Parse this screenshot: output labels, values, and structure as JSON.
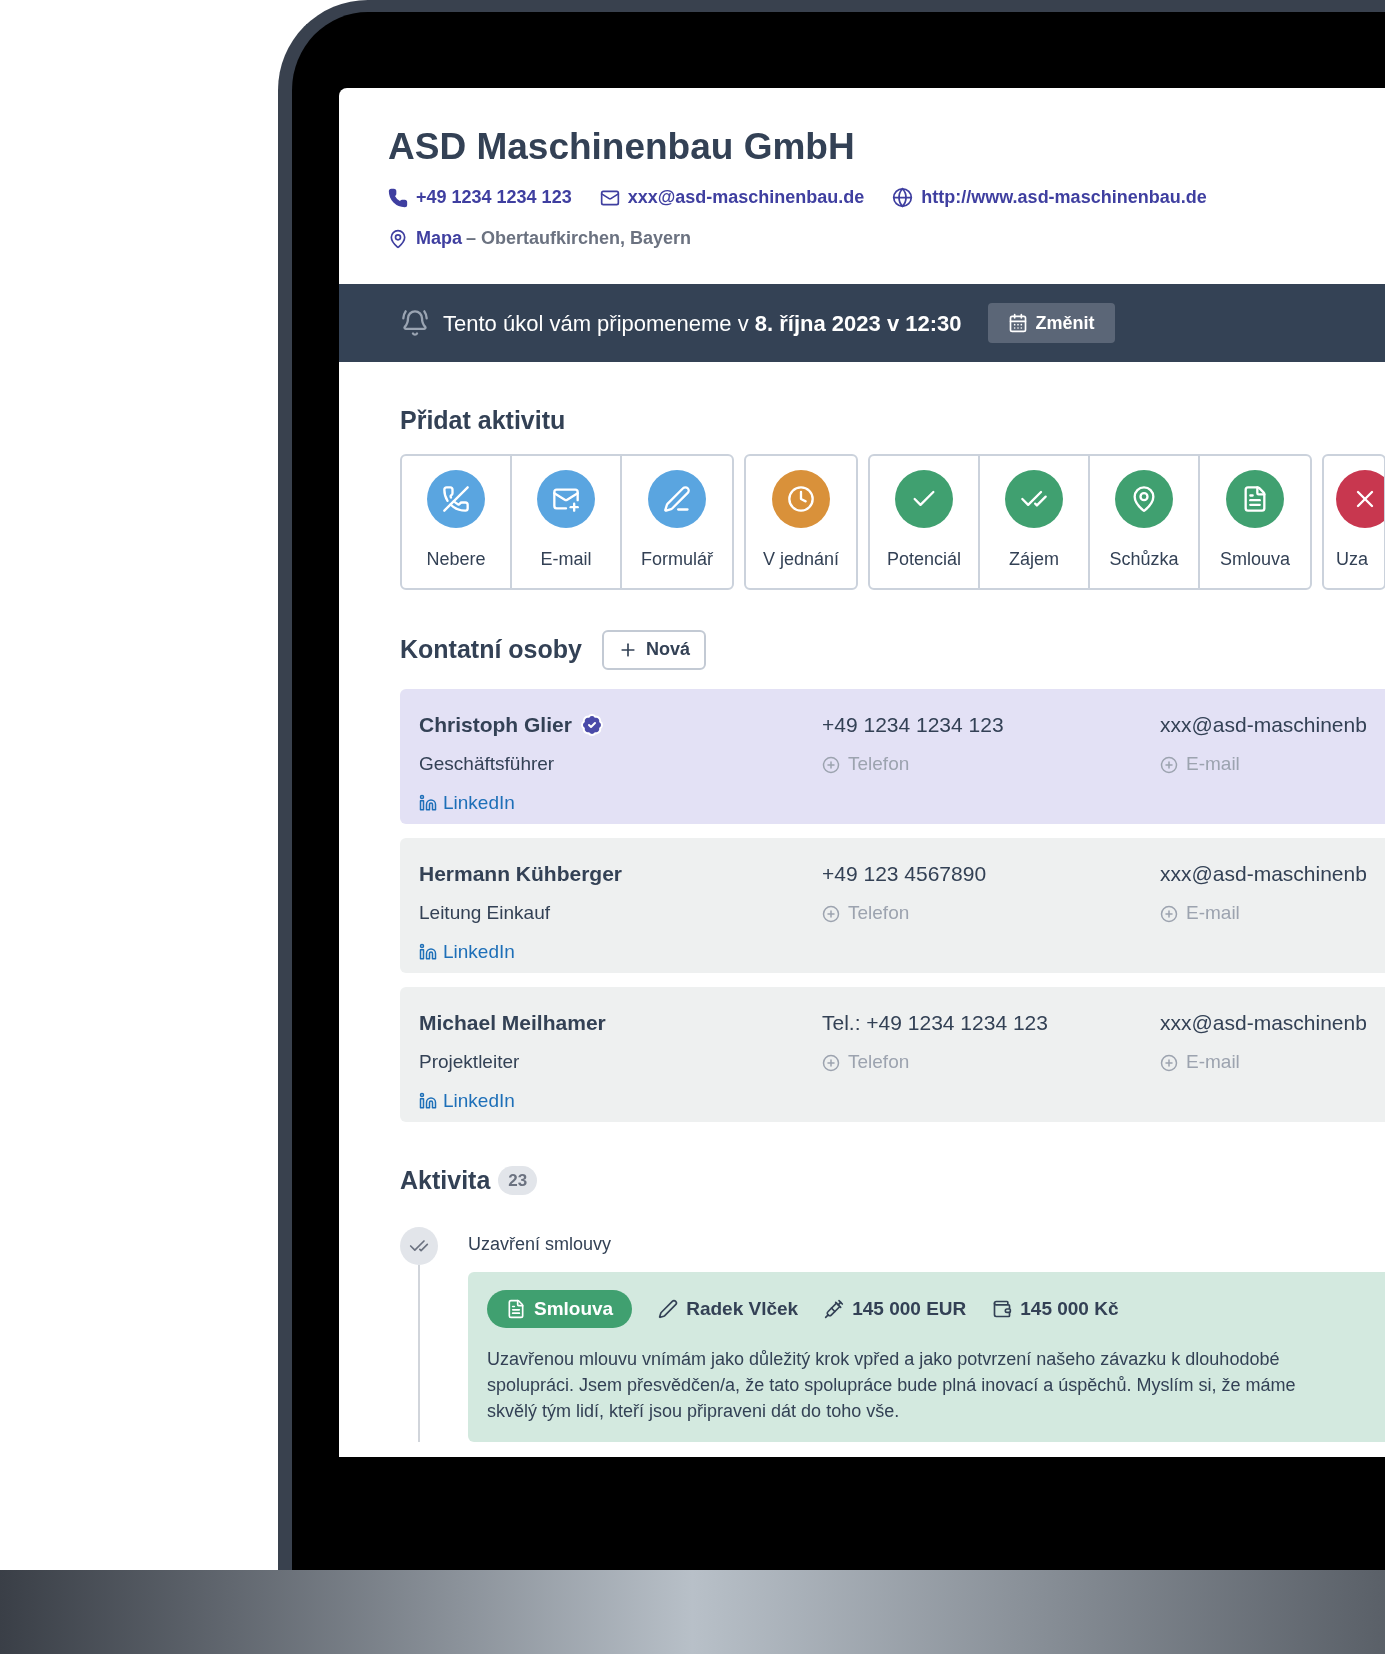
{
  "company": {
    "name": "ASD Maschinenbau GmbH",
    "phone": "+49 1234 1234 123",
    "email": "xxx@asd-maschinenbau.de",
    "website": "http://www.asd-maschinenbau.de",
    "map_link": "Mapa",
    "location": "– Obertaufkirchen, Bayern"
  },
  "reminder": {
    "text": "Tento úkol vám připomeneme v **8. října 2023 v 12:30**",
    "button": "Změnit"
  },
  "add_activity": {
    "title": "Přidat aktivitu",
    "groups": [
      {
        "items": [
          {
            "label": "Nebere",
            "color": "#5aa5e0"
          },
          {
            "label": "E-mail",
            "color": "#5aa5e0"
          },
          {
            "label": "Formulář",
            "color": "#5aa5e0"
          }
        ]
      },
      {
        "items": [
          {
            "label": "V jednání",
            "color": "#d9913a"
          }
        ]
      },
      {
        "items": [
          {
            "label": "Potenciál",
            "color": "#40a070"
          },
          {
            "label": "Zájem",
            "color": "#40a070"
          },
          {
            "label": "Schůzka",
            "color": "#40a070"
          },
          {
            "label": "Smlouva",
            "color": "#40a070"
          }
        ]
      },
      {
        "items": [
          {
            "label": "Uza",
            "color": "#c8374f"
          }
        ]
      }
    ]
  },
  "contacts": {
    "title": "Kontatní osoby",
    "new_button": "Nová",
    "people": [
      {
        "name": "Christoph Glier",
        "verified": true,
        "selected": true,
        "role": "Geschäftsführer",
        "linkedin": "LinkedIn",
        "phone": "+49 1234 1234 123",
        "phone_hint": "Telefon",
        "email": "xxx@asd-maschinenb",
        "email_hint": "E-mail"
      },
      {
        "name": "Hermann Kühberger",
        "verified": false,
        "selected": false,
        "role": "Leitung Einkauf",
        "linkedin": "LinkedIn",
        "phone": "+49 123 4567890",
        "phone_hint": "Telefon",
        "email": "xxx@asd-maschinenb",
        "email_hint": "E-mail"
      },
      {
        "name": "Michael Meilhamer",
        "verified": false,
        "selected": false,
        "role": "Projektleiter",
        "linkedin": "LinkedIn",
        "phone": "Tel.: +49 1234 1234 123",
        "phone_hint": "Telefon",
        "email": "xxx@asd-maschinenb",
        "email_hint": "E-mail"
      }
    ]
  },
  "activity": {
    "title": "Aktivita",
    "count": "23",
    "items": [
      {
        "title": "Uzavření smlouvy",
        "tag": "Smlouva",
        "author": "Radek Vlček",
        "amount_eur": "145 000 EUR",
        "amount_czk": "145 000 Kč",
        "note": "Uzavřenou mlouvu vnímám jako důležitý krok vpřed a jako potvrzení našeho závazku k dlouhodobé spolupráci. Jsem přesvědčen/a, že tato spolupráce bude plná inovací a úspěchů. Myslím si, že máme skvělý tým lidí, kteří jsou připraveni dát do toho vše."
      }
    ]
  }
}
